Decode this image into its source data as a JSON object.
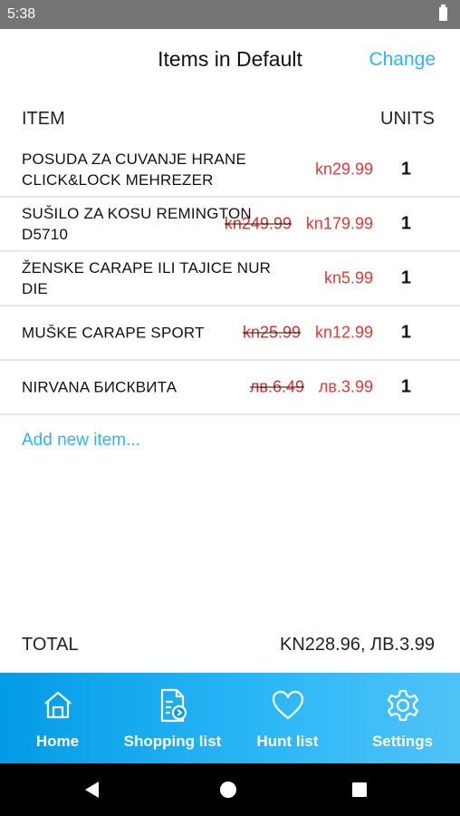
{
  "status_bar": {
    "time": "5:38"
  },
  "app_bar": {
    "title": "Items in Default",
    "change_label": "Change"
  },
  "columns": {
    "item": "ITEM",
    "units": "UNITS"
  },
  "items": [
    {
      "name": "POSUDA ZA CUVANJE HRANE CLICK&LOCK MEHREZER",
      "old_price": null,
      "price": "kn29.99",
      "units": "1"
    },
    {
      "name": "SUŠILO ZA KOSU REMINGTON D5710",
      "old_price": "kn249.99",
      "price": "kn179.99",
      "units": "1"
    },
    {
      "name": "ŽENSKE CARAPE ILI TAJICE NUR DIE",
      "old_price": null,
      "price": "kn5.99",
      "units": "1"
    },
    {
      "name": "MUŠKE CARAPE SPORT",
      "old_price": "kn25.99",
      "price": "kn12.99",
      "units": "1"
    },
    {
      "name": "NIRVANA БИСКВИТА",
      "old_price": "лв.6.49",
      "price": "лв.3.99",
      "units": "1"
    }
  ],
  "add_item_label": "Add new item...",
  "total": {
    "label": "TOTAL",
    "value": "KN228.96, ЛВ.3.99"
  },
  "bottom_nav": [
    {
      "label": "Home",
      "icon": "home-icon"
    },
    {
      "label": "Shopping list",
      "icon": "shopping-list-icon"
    },
    {
      "label": "Hunt list",
      "icon": "heart-icon"
    },
    {
      "label": "Settings",
      "icon": "gear-icon"
    }
  ],
  "colors": {
    "accent": "#29b6f6",
    "price": "#e53935",
    "nav_bg": "#039be5"
  }
}
